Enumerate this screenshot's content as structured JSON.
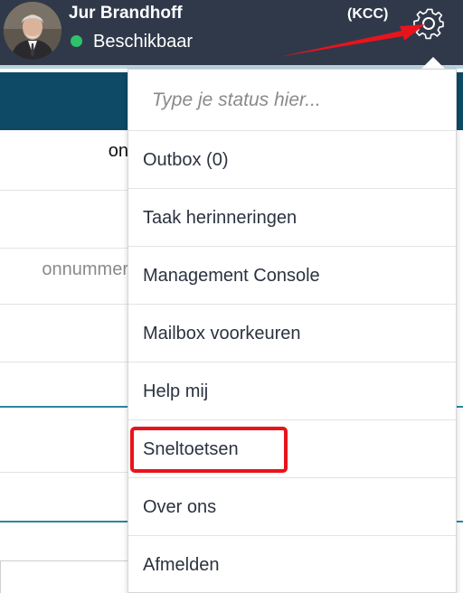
{
  "header": {
    "user_name": "Jur Brandhoff",
    "tag": "(KCC)",
    "status": "Beschikbaar",
    "status_color": "#2ec26a",
    "background_color": "#30394a"
  },
  "background_page": {
    "rows": [
      "on",
      "",
      "onnummer",
      "",
      "",
      "",
      "",
      ""
    ]
  },
  "dropdown": {
    "status_placeholder": "Type je status hier...",
    "items": [
      {
        "label": "Outbox (0)"
      },
      {
        "label": "Taak herinneringen"
      },
      {
        "label": "Management Console"
      },
      {
        "label": "Mailbox voorkeuren"
      },
      {
        "label": "Help mij"
      },
      {
        "label": "Sneltoetsen"
      },
      {
        "label": "Over ons"
      },
      {
        "label": "Afmelden"
      }
    ]
  },
  "annotations": {
    "highlight_color": "#e8141b",
    "arrow_target": "gear-icon",
    "highlighted_item": "Sneltoetsen"
  }
}
